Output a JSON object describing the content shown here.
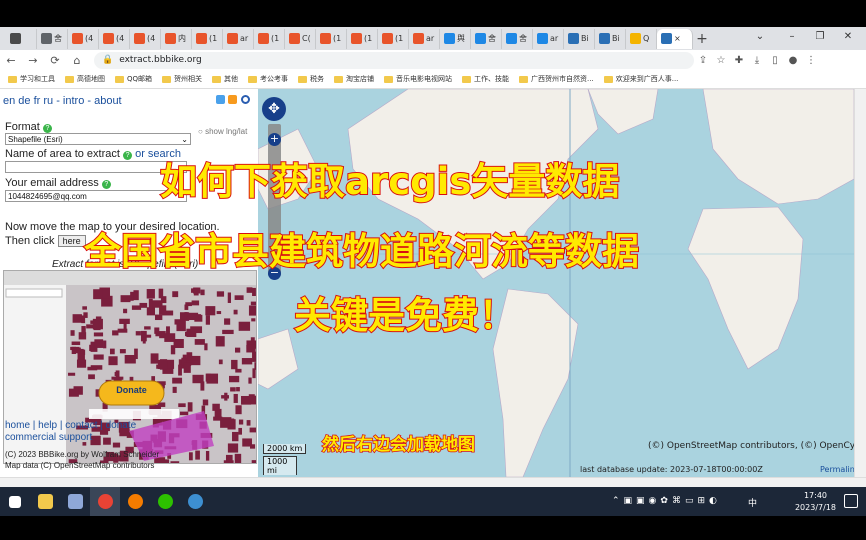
{
  "browser": {
    "tabs": [
      {
        "label": "",
        "color": "#4a4a4a"
      },
      {
        "label": "舍",
        "color": "#5f6368"
      },
      {
        "label": "(4",
        "color": "#e8542b"
      },
      {
        "label": "(4",
        "color": "#e8542b"
      },
      {
        "label": "(4",
        "color": "#e8542b"
      },
      {
        "label": "内",
        "color": "#e8542b"
      },
      {
        "label": "(1",
        "color": "#e8542b"
      },
      {
        "label": "ar",
        "color": "#e8542b"
      },
      {
        "label": "(1",
        "color": "#e8542b"
      },
      {
        "label": "C(",
        "color": "#e8542b"
      },
      {
        "label": "(1",
        "color": "#e8542b"
      },
      {
        "label": "(1",
        "color": "#e8542b"
      },
      {
        "label": "(1",
        "color": "#e8542b"
      },
      {
        "label": "ar",
        "color": "#e8542b"
      },
      {
        "label": "舆",
        "color": "#1e88e5"
      },
      {
        "label": "舍",
        "color": "#1e88e5"
      },
      {
        "label": "舍",
        "color": "#1e88e5"
      },
      {
        "label": "ar",
        "color": "#1e88e5"
      },
      {
        "label": "Bi",
        "color": "#2a6fb5"
      },
      {
        "label": "Bi",
        "color": "#2a6fb5"
      },
      {
        "label": "Q",
        "color": "#f4b400"
      },
      {
        "label": "×",
        "color": "#2a6fb5"
      }
    ],
    "new_tab": "+",
    "window_controls": [
      "⌄",
      "–",
      "❐",
      "✕"
    ],
    "url": "extract.bbbike.org",
    "bookmarks": [
      "学习和工具",
      "高德地图",
      "QQ邮箱",
      "贺州相关",
      "其他",
      "考公考事",
      "税务",
      "淘宝店铺",
      "音乐电影电视网站",
      "工作、技能",
      "广西贺州市自然资...",
      "欢迎来到广西人事..."
    ]
  },
  "page": {
    "lang_links": "en de fr ru - intro - about",
    "format_label": "Format",
    "format_value": "Shapefile (Esri)",
    "show_lnglat": "show lng/lat",
    "area_label": "Name of area to extract",
    "or_search": "or search",
    "email_label": "Your email address",
    "email_value": "1044824695@qq.com",
    "move_map_text": "Now move the map to your desired location.",
    "then_click": "Then click",
    "here_button": "here",
    "extract_format": "Extract format is: Shapefile (Esri)",
    "donate": "Donate",
    "footer_links": "home | help | contact | donate",
    "commercial": "commercial support",
    "copyright": "(C) 2023 BBBike.org by Wolfram Schneider",
    "map_data": "Map data (C) OpenStreetMap contributors",
    "scale_km": "2000 km",
    "scale_mi": "1000 mi",
    "attribution": "(©) OpenStreetMap contributors, (©) OpenCycleMap",
    "last_update": "last database update: 2023-07-18T00:00:00Z",
    "permalink": "Permalink"
  },
  "overlay": {
    "line1": "如何下获取arcgis矢量数据",
    "line2": "全国省市县建筑物道路河流等数据",
    "line3": "关键是免费！",
    "caption": "然后右边会加载地图"
  },
  "taskbar": {
    "time": "17:40",
    "date": "2023/7/18",
    "ime": "中"
  },
  "colors": {
    "overlay_fill": "#ffea00",
    "overlay_stroke": "#d81010",
    "ocean": "#aad3df",
    "land": "#f2efe9"
  }
}
